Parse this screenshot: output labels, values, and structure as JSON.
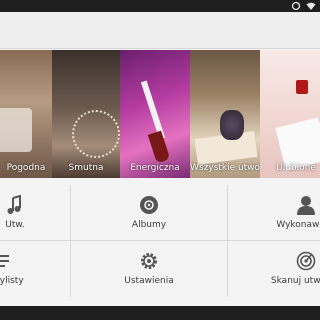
{
  "status_bar": {
    "icons": [
      "sync-icon",
      "wifi-icon"
    ]
  },
  "categories": [
    {
      "label": "Pogodna"
    },
    {
      "label": "Smutna"
    },
    {
      "label": "Energiczna"
    },
    {
      "label": "Wszystkie utwory"
    },
    {
      "label": "Ulubione"
    }
  ],
  "menu": [
    {
      "label": "Utw.",
      "icon": "music-note-icon"
    },
    {
      "label": "Albumy",
      "icon": "album-icon"
    },
    {
      "label": "Wykonawcy",
      "icon": "person-icon"
    },
    {
      "label": "Playlisty",
      "icon": "playlist-icon"
    },
    {
      "label": "Ustawienia",
      "icon": "gear-icon"
    },
    {
      "label": "Skanuj utwory",
      "icon": "scan-icon"
    }
  ],
  "colors": {
    "status_bar": "#1e1e1e",
    "background": "#f4f4f4",
    "icon": "#555555"
  }
}
